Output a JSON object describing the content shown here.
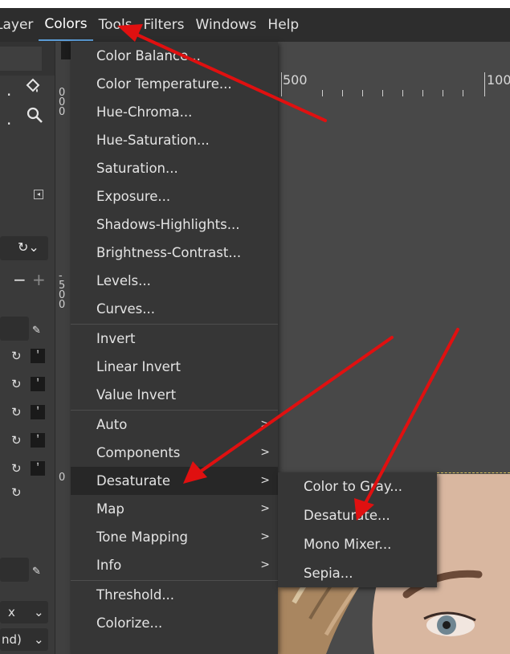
{
  "menubar": {
    "items": [
      {
        "label": "Layer",
        "active": false
      },
      {
        "label": "Colors",
        "active": true
      },
      {
        "label": "Tools",
        "active": false
      },
      {
        "label": "Filters",
        "active": false
      },
      {
        "label": "Windows",
        "active": false
      },
      {
        "label": "Help",
        "active": false
      }
    ]
  },
  "colors_menu": {
    "items": [
      {
        "label": "Color Balance...",
        "submenu": false
      },
      {
        "label": "Color Temperature...",
        "submenu": false
      },
      {
        "label": "Hue-Chroma...",
        "submenu": false
      },
      {
        "label": "Hue-Saturation...",
        "submenu": false
      },
      {
        "label": "Saturation...",
        "submenu": false
      },
      {
        "label": "Exposure...",
        "submenu": false
      },
      {
        "label": "Shadows-Highlights...",
        "submenu": false
      },
      {
        "label": "Brightness-Contrast...",
        "submenu": false
      },
      {
        "label": "Levels...",
        "submenu": false
      },
      {
        "label": "Curves...",
        "submenu": false
      },
      {
        "label": "Invert",
        "submenu": false
      },
      {
        "label": "Linear Invert",
        "submenu": false
      },
      {
        "label": "Value Invert",
        "submenu": false
      },
      {
        "label": "Auto",
        "submenu": true
      },
      {
        "label": "Components",
        "submenu": true
      },
      {
        "label": "Desaturate",
        "submenu": true,
        "highlighted": true
      },
      {
        "label": "Map",
        "submenu": true
      },
      {
        "label": "Tone Mapping",
        "submenu": true
      },
      {
        "label": "Info",
        "submenu": true
      },
      {
        "label": "Threshold...",
        "submenu": false
      },
      {
        "label": "Colorize...",
        "submenu": false
      }
    ],
    "submenu_arrow": ">"
  },
  "desaturate_submenu": {
    "items": [
      {
        "label": "Color to Gray..."
      },
      {
        "label": "Desaturate..."
      },
      {
        "label": "Mono Mixer..."
      },
      {
        "label": "Sepia..."
      }
    ]
  },
  "ruler": {
    "h_labels": [
      "500",
      "100"
    ],
    "v_labels": [
      "0",
      "0",
      "0",
      "-",
      "5",
      "0",
      "0",
      "0"
    ]
  },
  "left_panel": {
    "tools": [
      "bucket-fill-icon",
      "zoom-icon"
    ],
    "dropdown_1": "x",
    "dropdown_2": "nd)",
    "minus": "−",
    "plus": "+"
  },
  "annotations": {
    "arrow_color": "#e01010"
  }
}
